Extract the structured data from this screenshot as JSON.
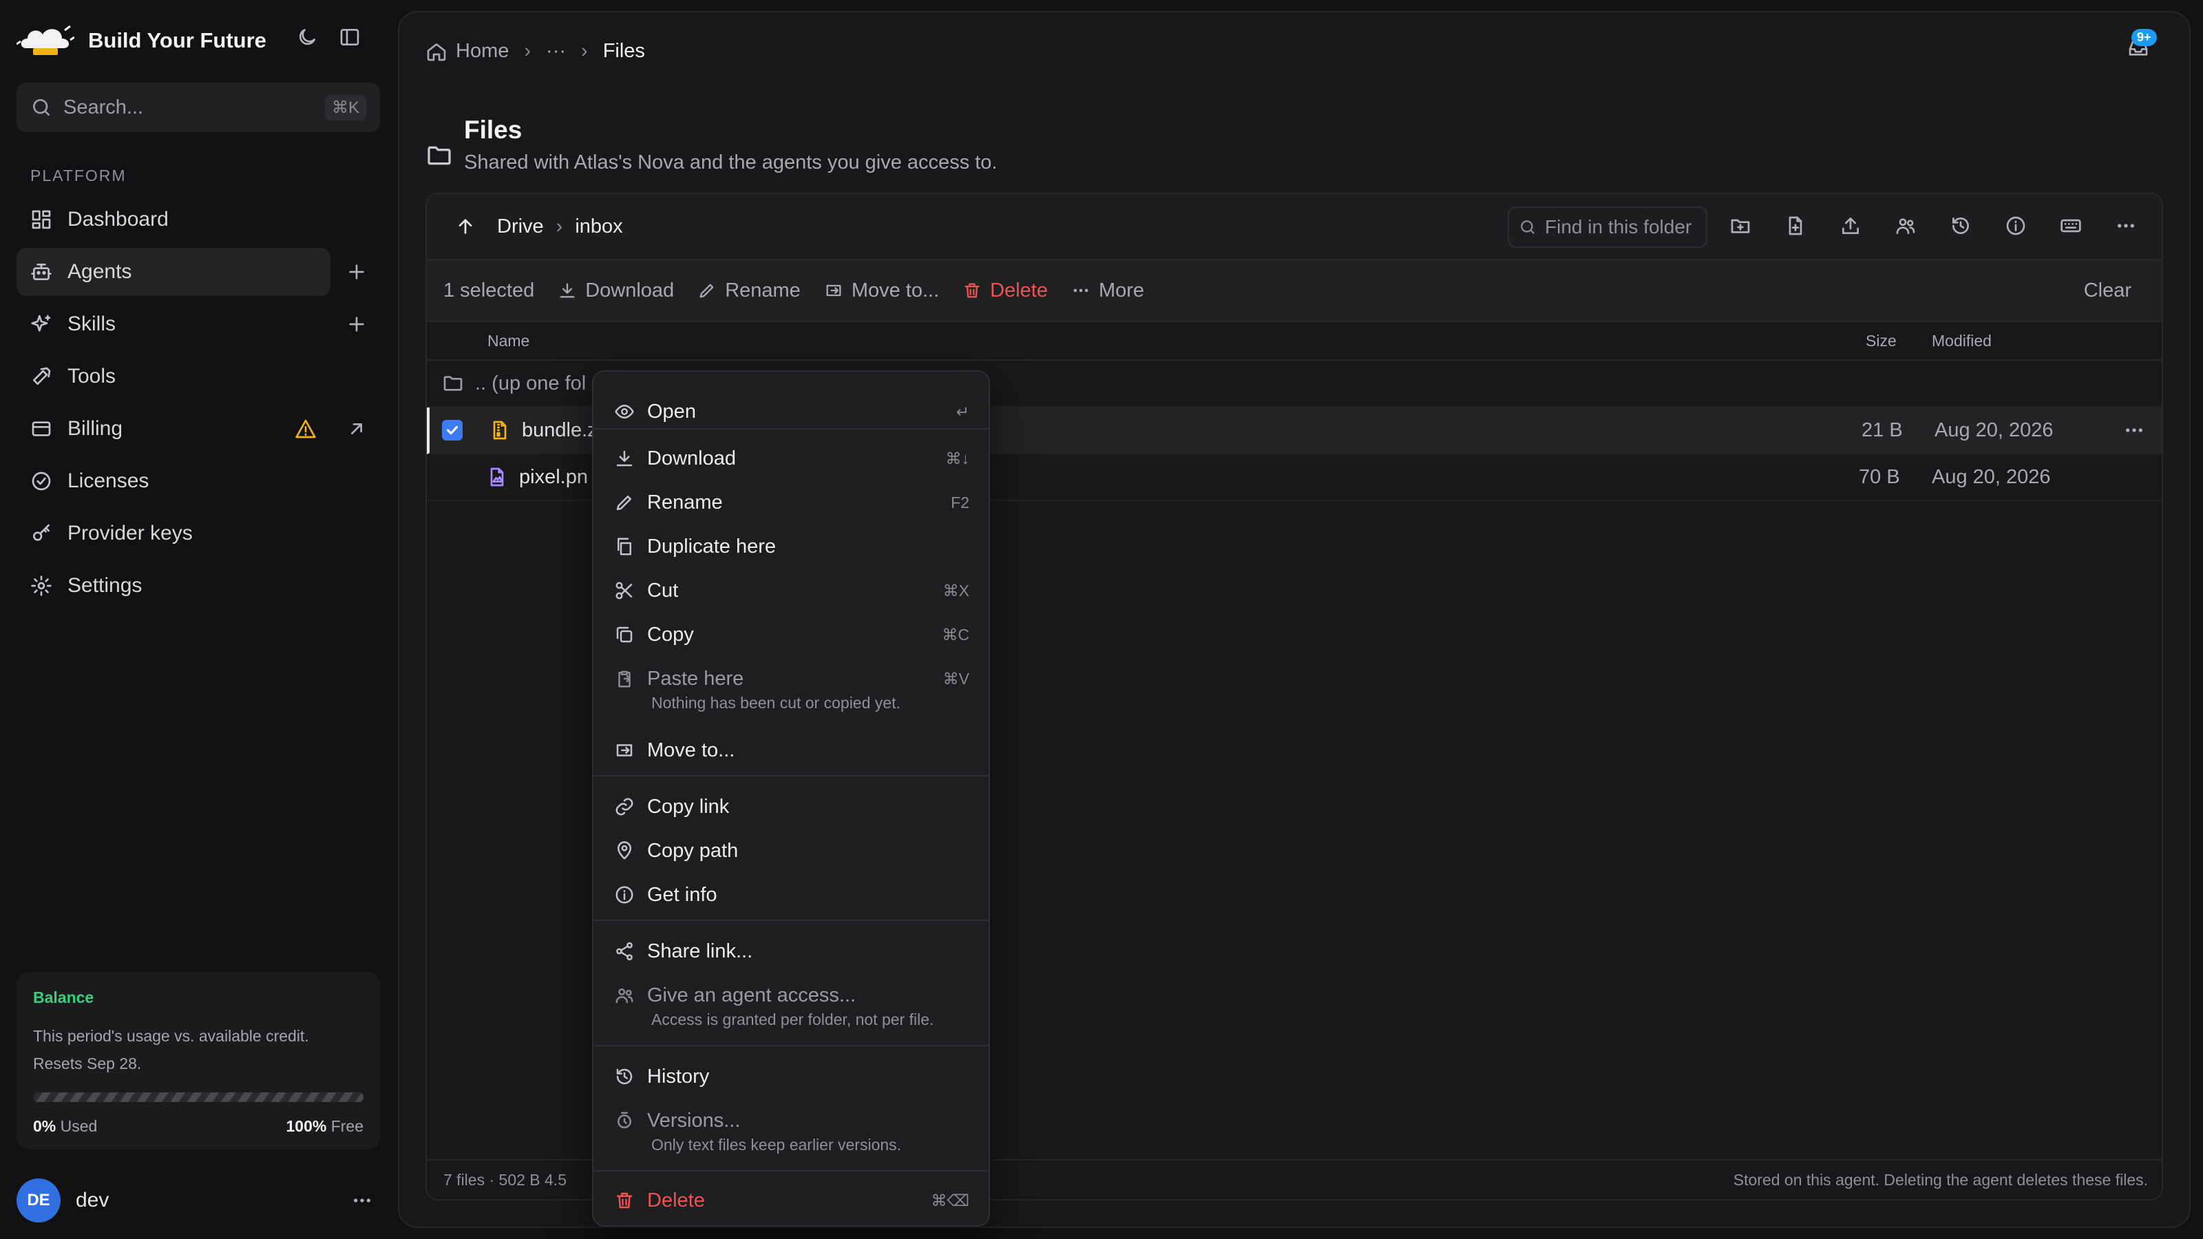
{
  "brand": {
    "name": "Build Your Future"
  },
  "search": {
    "placeholder": "Search...",
    "shortcut": "⌘K"
  },
  "sidebar": {
    "section": "PLATFORM",
    "items": [
      {
        "label": "Dashboard",
        "icon": "dashboard-icon"
      },
      {
        "label": "Agents",
        "icon": "bot-icon",
        "active": true
      },
      {
        "label": "Skills",
        "icon": "sparkles-icon"
      },
      {
        "label": "Tools",
        "icon": "hammer-icon"
      },
      {
        "label": "Billing",
        "icon": "credit-card-icon",
        "warning": true
      },
      {
        "label": "Licenses",
        "icon": "badge-check-icon"
      },
      {
        "label": "Provider keys",
        "icon": "key-icon"
      },
      {
        "label": "Settings",
        "icon": "gear-icon"
      }
    ]
  },
  "balance": {
    "title": "Balance",
    "desc_line1": "This period's usage vs. available credit.",
    "desc_line2": "Resets Sep 28.",
    "used_value": "0%",
    "used_label": "Used",
    "free_value": "100%",
    "free_label": "Free",
    "used_fraction": 0
  },
  "user": {
    "initials": "DE",
    "name": "dev"
  },
  "breadcrumb": {
    "home": "Home",
    "ellipsis": "···",
    "current": "Files"
  },
  "notifications": {
    "badge": "9+"
  },
  "page": {
    "title": "Files",
    "subtitle": "Shared with Atlas's Nova and the agents you give access to."
  },
  "browser": {
    "path": [
      "Drive",
      "inbox"
    ],
    "find_placeholder": "Find in this folder",
    "selection": {
      "count": "1 selected",
      "download": "Download",
      "rename": "Rename",
      "move": "Move to...",
      "delete": "Delete",
      "more": "More",
      "clear": "Clear"
    },
    "columns": {
      "name": "Name",
      "size": "Size",
      "modified": "Modified"
    },
    "up_row": ".. (up one fol",
    "rows": [
      {
        "name": "bundle.z",
        "size": "21 B",
        "modified": "Aug 20, 2026",
        "selected": true,
        "icon": "archive-file-icon"
      },
      {
        "name": "pixel.pn",
        "size": "70 B",
        "modified": "Aug 20, 2026",
        "selected": false,
        "icon": "image-file-icon"
      }
    ],
    "status_left": "7 files · 502 B   4.5",
    "status_right": "Stored on this agent. Deleting the agent deletes these files."
  },
  "menu": {
    "open": {
      "label": "Open",
      "shortcut": "↵"
    },
    "download": {
      "label": "Download",
      "shortcut": "⌘↓"
    },
    "rename": {
      "label": "Rename",
      "shortcut": "F2"
    },
    "duplicate": {
      "label": "Duplicate here"
    },
    "cut": {
      "label": "Cut",
      "shortcut": "⌘X"
    },
    "copy": {
      "label": "Copy",
      "shortcut": "⌘C"
    },
    "paste": {
      "label": "Paste here",
      "shortcut": "⌘V",
      "hint": "Nothing has been cut or copied yet."
    },
    "move": {
      "label": "Move to..."
    },
    "copy_link": {
      "label": "Copy link"
    },
    "copy_path": {
      "label": "Copy path"
    },
    "get_info": {
      "label": "Get info"
    },
    "share": {
      "label": "Share link..."
    },
    "give_access": {
      "label": "Give an agent access...",
      "hint": "Access is granted per folder, not per file."
    },
    "history": {
      "label": "History"
    },
    "versions": {
      "label": "Versions...",
      "hint": "Only text files keep earlier versions."
    },
    "delete": {
      "label": "Delete",
      "shortcut": "⌘⌫"
    }
  },
  "colors": {
    "accent": "#3b7bf5",
    "danger": "#f05252",
    "warning": "#f2b318",
    "success": "#37d07f",
    "badge": "#1d9bf0"
  }
}
